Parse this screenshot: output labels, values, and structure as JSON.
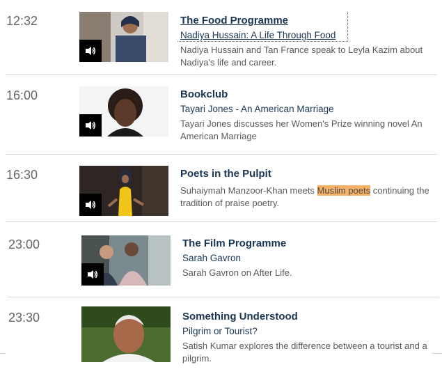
{
  "schedule": [
    {
      "time": "12:32",
      "title": "The Food Programme",
      "subtitle": "Nadiya Hussain: A Life Through Food",
      "desc": "Nadiya Hussain and Tan France speak to Leyla Kazim about Nadiya's life and career.",
      "icon": "speaker-icon"
    },
    {
      "time": "16:00",
      "title": "Bookclub",
      "subtitle": "Tayari Jones - An American Marriage",
      "desc": "Tayari Jones discusses her Women's Prize winning novel An American Marriage",
      "icon": "speaker-icon"
    },
    {
      "time": "16:30",
      "title": "Poets in the Pulpit",
      "desc_before": "Suhaiymah Manzoor-Khan meets ",
      "desc_highlight": "Muslim poets",
      "desc_after": " continuing the tradition of praise poetry.",
      "icon": "speaker-icon"
    },
    {
      "time": "23:00",
      "title": "The Film Programme",
      "subtitle": "Sarah Gavron",
      "desc": "Sarah Gavron on After Life.",
      "icon": "speaker-icon"
    },
    {
      "time": "23:30",
      "title": "Something Understood",
      "subtitle": "Pilgrim or Tourist?",
      "desc": "Satish Kumar explores the difference between a tourist and a pilgrim."
    }
  ],
  "colors": {
    "title": "#193653",
    "highlight": "#f7b267",
    "divider": "#d6d6d6"
  }
}
